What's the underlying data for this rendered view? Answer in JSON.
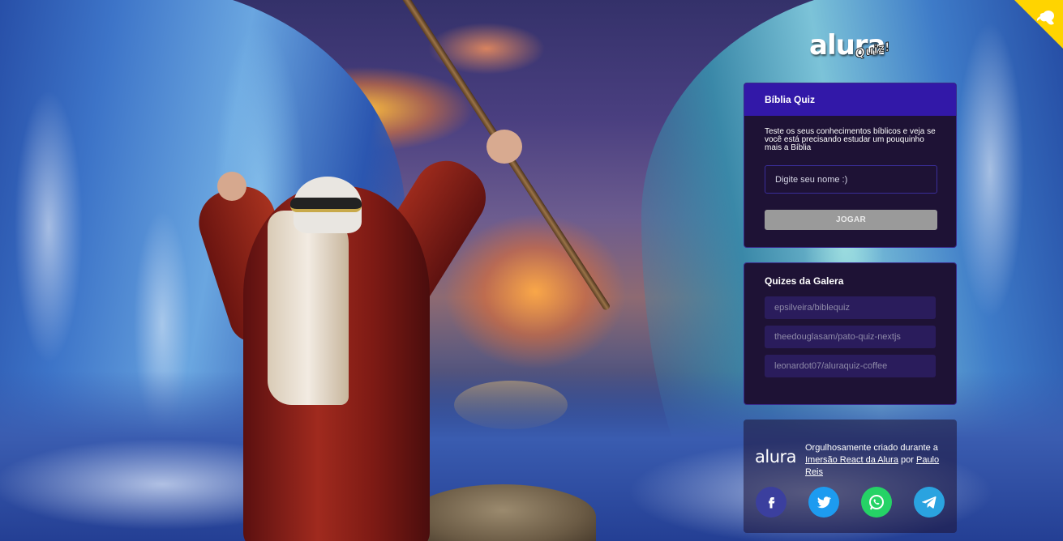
{
  "brand": {
    "logo_main": "alura",
    "logo_sub": "Quiz!"
  },
  "main_widget": {
    "title": "Bíblia Quiz",
    "description": "Teste os seus conhecimentos bíblicos e veja se você está precisando estudar um pouquinho mais a Bíblia",
    "name_input": {
      "value": "",
      "placeholder": "Digite seu nome :)"
    },
    "play_button": "JOGAR"
  },
  "community_widget": {
    "title": "Quizes da Galera",
    "links": [
      "epsilveira/biblequiz",
      "theedouglasam/pato-quiz-nextjs",
      "leonardot07/aluraquiz-coffee"
    ]
  },
  "footer": {
    "logo": "alura",
    "text_prefix": "Orgulhosamente criado durante a",
    "link_event": "Imersão React da Alura",
    "text_middle": "por",
    "link_author": "Paulo Reis",
    "social": [
      "facebook-icon",
      "twitter-icon",
      "whatsapp-icon",
      "telegram-icon"
    ]
  },
  "colors": {
    "header_bg": "#3218a8",
    "widget_bg": "#1e1235",
    "corner": "#ffd400"
  }
}
